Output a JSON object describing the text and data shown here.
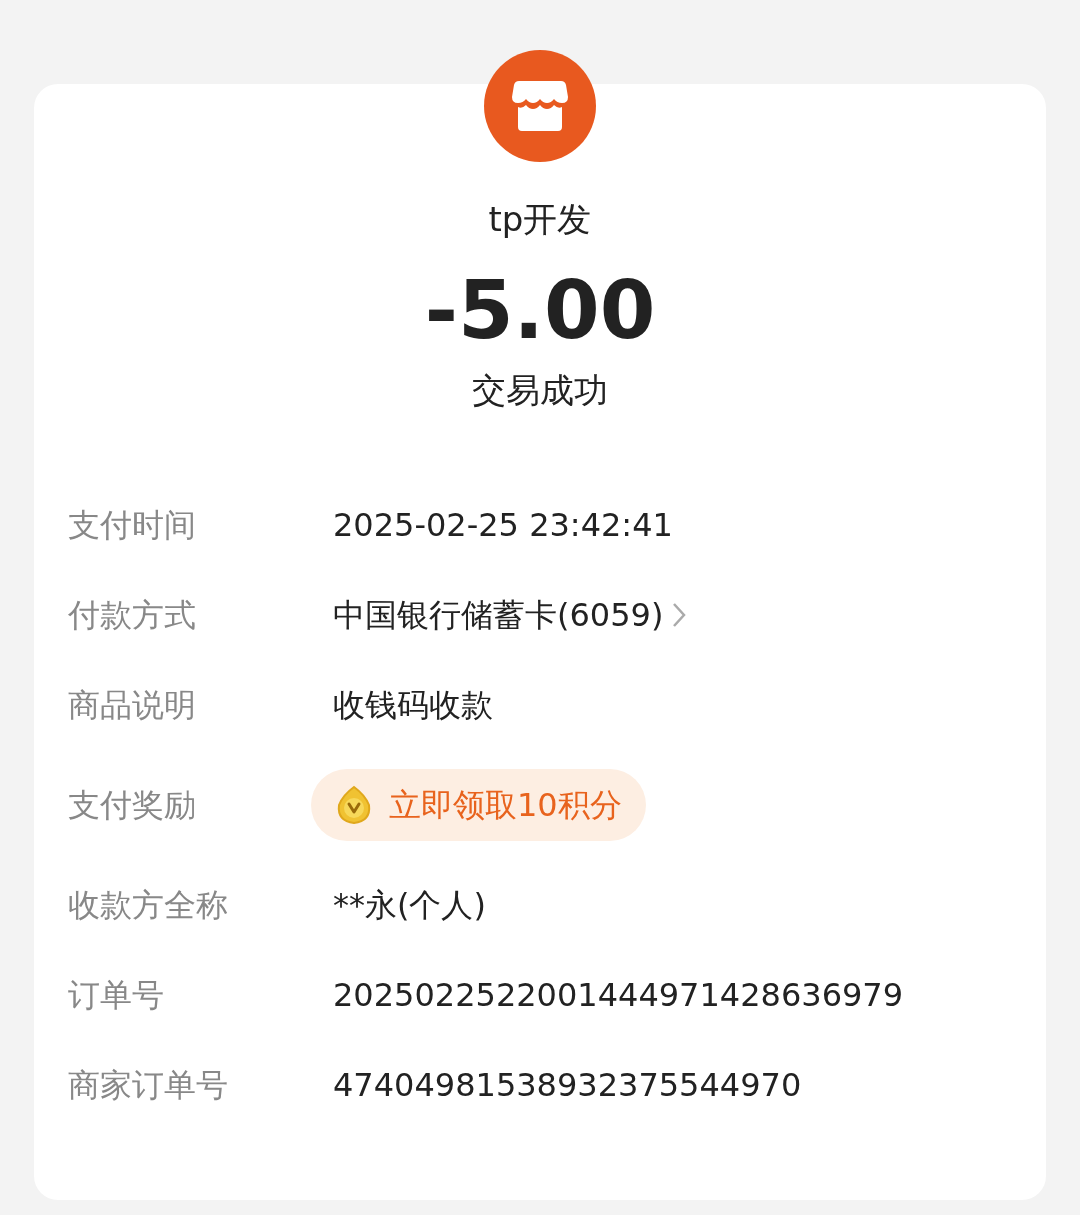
{
  "merchant": {
    "name": "tp开发"
  },
  "amount": "-5.00",
  "status": "交易成功",
  "details": [
    {
      "kind": "text",
      "label": "支付时间",
      "value": "2025-02-25 23:42:41"
    },
    {
      "kind": "link",
      "label": "付款方式",
      "value": "中国银行储蓄卡(6059)"
    },
    {
      "kind": "text",
      "label": "商品说明",
      "value": "收钱码收款"
    },
    {
      "kind": "reward",
      "label": "支付奖励",
      "value": "立即领取10积分"
    },
    {
      "kind": "text",
      "label": "收款方全称",
      "value": "**永(个人)"
    },
    {
      "kind": "text",
      "label": "订单号",
      "value": "2025022522001444971428636979"
    },
    {
      "kind": "text",
      "label": "商家订单号",
      "value": "47404981538932375544970"
    }
  ]
}
